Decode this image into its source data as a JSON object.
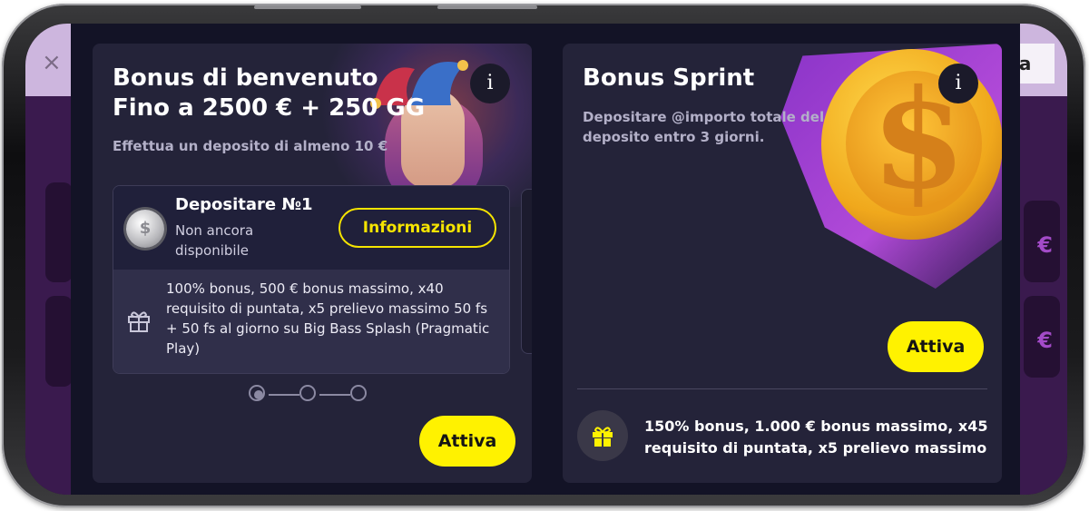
{
  "background": {
    "close_glyph": "×",
    "language_label": "la",
    "currency_glyph": "€"
  },
  "welcome_card": {
    "title_line1": "Bonus di benvenuto",
    "title_line2": "Fino a 2500 € + 250 GG",
    "subtitle": "Effettua un deposito di almeno 10 €",
    "info_glyph": "i",
    "deposit": {
      "title": "Depositare №1",
      "status": "Non ancora disponibile",
      "info_button_label": "Informazioni",
      "description": "100% bonus, 500 € bonus massimo, x40 requisito di puntata, x5 prelievo massimo 50 fs + 50 fs al giorno su Big Bass Splash (Pragmatic Play)"
    },
    "stepper": {
      "total": 3,
      "active": 1
    },
    "activate_label": "Attiva"
  },
  "sprint_card": {
    "title": "Bonus Sprint",
    "subtitle": "Depositare @importo totale del deposito entro 3 giorni.",
    "info_glyph": "i",
    "activate_label": "Attiva",
    "description": "150% bonus, 1.000 € bonus massimo, x45 requisito di puntata, x5 prelievo massimo"
  },
  "colors": {
    "accent_yellow": "#fff200",
    "card_bg": "#242339",
    "modal_bg": "#131326"
  },
  "icons": [
    "close-icon",
    "info-icon",
    "silver-coin-icon",
    "gift-icon",
    "gold-coin-illustration",
    "jester-illustration"
  ]
}
